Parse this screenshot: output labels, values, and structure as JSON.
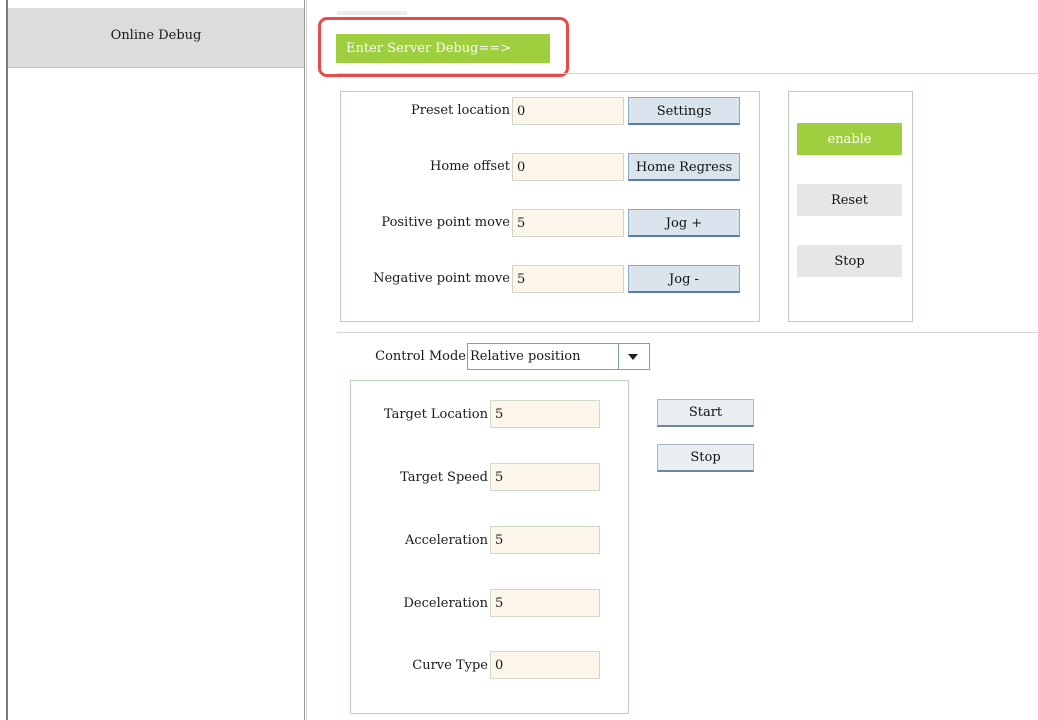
{
  "sidebar": {
    "items": [
      {
        "label": "Online Debug"
      }
    ]
  },
  "header": {
    "enter_debug_label": "Enter Server Debug==>"
  },
  "point_panel": {
    "rows": [
      {
        "label": "Preset location",
        "value": "0",
        "button": "Settings"
      },
      {
        "label": "Home offset",
        "value": "0",
        "button": "Home Regress"
      },
      {
        "label": "Positive point move",
        "value": "5",
        "button": "Jog +"
      },
      {
        "label": "Negative point move",
        "value": "5",
        "button": "Jog -"
      }
    ]
  },
  "state_panel": {
    "enable_label": "enable",
    "reset_label": "Reset",
    "stop_label": "Stop"
  },
  "control": {
    "mode_label": "Control Mode",
    "mode_value": "Relative position",
    "fields": [
      {
        "label": "Target Location",
        "value": "5"
      },
      {
        "label": "Target Speed",
        "value": "5"
      },
      {
        "label": "Acceleration",
        "value": "5"
      },
      {
        "label": "Deceleration",
        "value": "5"
      },
      {
        "label": "Curve Type",
        "value": "0"
      }
    ],
    "start_label": "Start",
    "stop_label": "Stop"
  },
  "colors": {
    "accent_green": "#9fcf3e",
    "highlight_red": "#e94b4b",
    "input_bg": "#fdf6ea",
    "panel_border": "#b7d3b7"
  },
  "icons": {
    "select_arrow": "triangle-down-icon"
  }
}
